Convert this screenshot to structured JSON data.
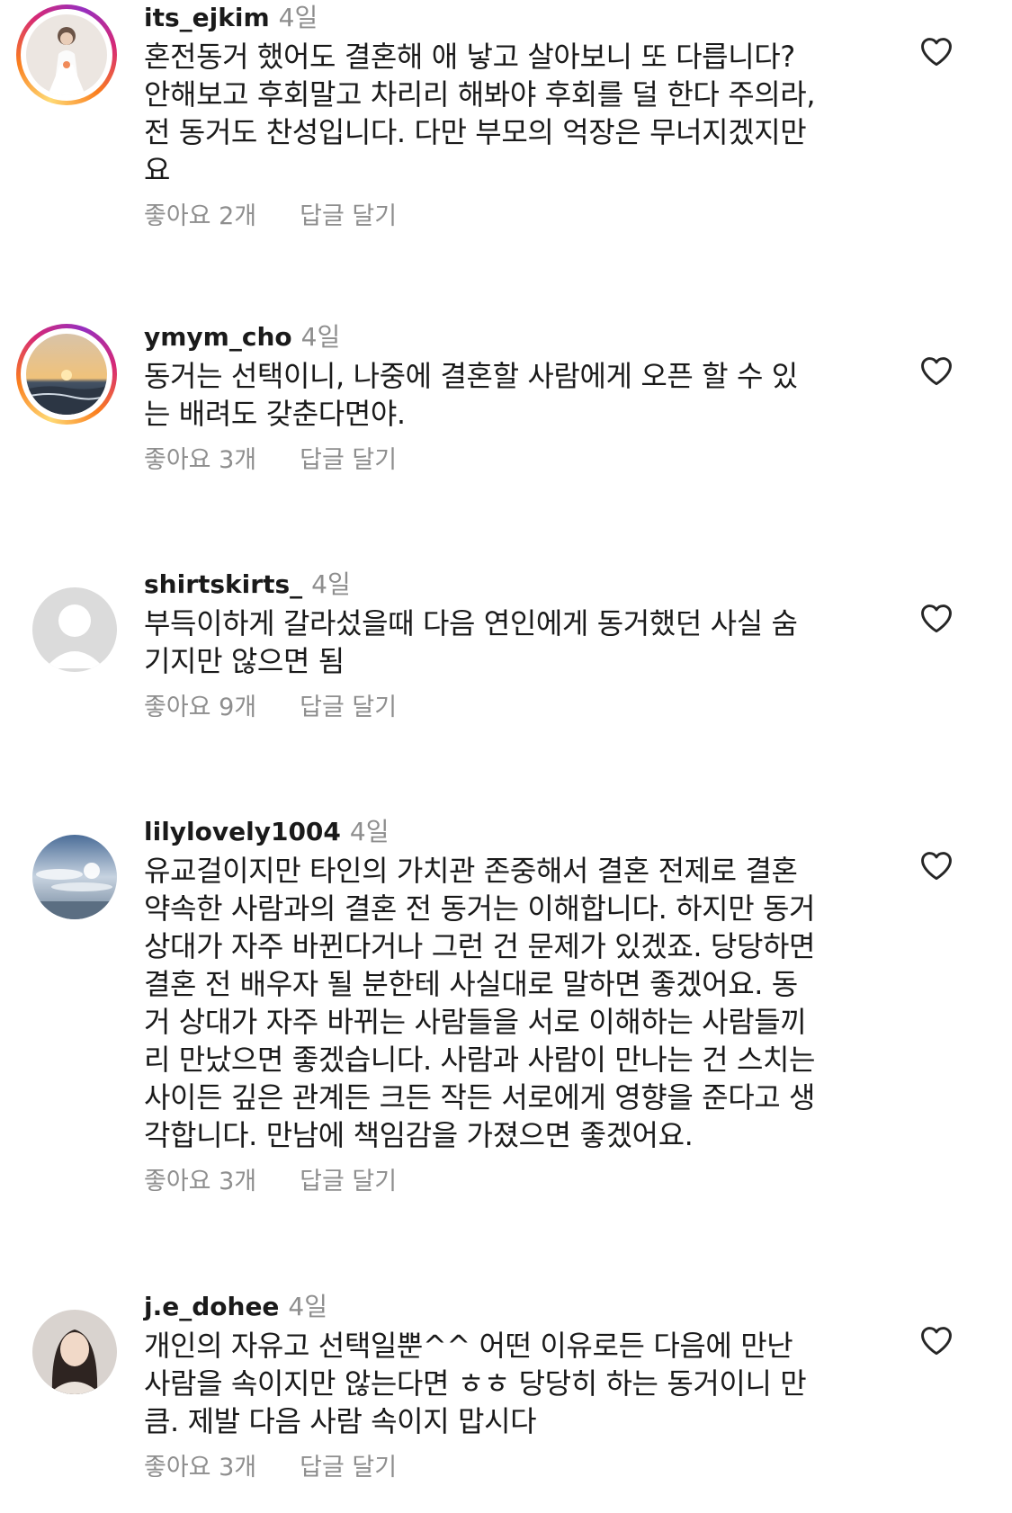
{
  "comments": [
    {
      "username": "its_ejkim",
      "time": "4일",
      "text": "혼전동거 했어도 결혼해 애 낳고 살아보니 또 다릅니다?\n안해보고 후회말고 차리리 해봐야 후회를 덜 한다 주의라,\n전 동거도 찬성입니다. 다만 부모의 억장은 무너지겠지만\n요",
      "likes": "좋아요 2개",
      "reply": "답글 달기"
    },
    {
      "username": "ymym_cho",
      "time": "4일",
      "text": "동거는 선택이니, 나중에 결혼할 사람에게 오픈 할 수 있\n는 배려도 갖춘다면야.",
      "likes": "좋아요 3개",
      "reply": "답글 달기"
    },
    {
      "username": "shirtskirts_",
      "time": "4일",
      "text": "부득이하게 갈라섰을때 다음 연인에게 동거했던 사실 숨\n기지만 않으면 됨",
      "likes": "좋아요 9개",
      "reply": "답글 달기"
    },
    {
      "username": "lilylovely1004",
      "time": "4일",
      "text": "유교걸이지만 타인의 가치관 존중해서 결혼 전제로 결혼\n약속한 사람과의 결혼 전 동거는 이해합니다. 하지만 동거\n상대가 자주 바뀐다거나 그런 건 문제가 있겠죠. 당당하면\n결혼 전 배우자 될 분한테 사실대로 말하면 좋겠어요. 동\n거 상대가 자주 바뀌는 사람들을 서로 이해하는 사람들끼\n리 만났으면 좋겠습니다. 사람과 사람이 만나는 건 스치는\n사이든 깊은 관계든 크든 작든 서로에게 영향을 준다고 생\n각합니다. 만남에 책임감을 가졌으면 좋겠어요.",
      "likes": "좋아요 3개",
      "reply": "답글 달기"
    },
    {
      "username": "j.e_dohee",
      "time": "4일",
      "text": "개인의 자유고 선택일뿐^^ 어떤 이유로든 다음에 만난\n사람을 속이지만 않는다면 ㅎㅎ 당당히 하는 동거이니 만\n큼. 제발 다음 사람 속이지 맙시다",
      "likes": "좋아요 3개",
      "reply": "답글 달기"
    }
  ],
  "icons": {
    "heart": "heart-outline-icon",
    "default_avatar": "person-silhouette-icon"
  },
  "colors": {
    "text": "#1a1a1a",
    "secondary": "#8e8e8e",
    "story_ring": [
      "#feda75",
      "#fa7e1e",
      "#d62976",
      "#962fbf"
    ]
  }
}
